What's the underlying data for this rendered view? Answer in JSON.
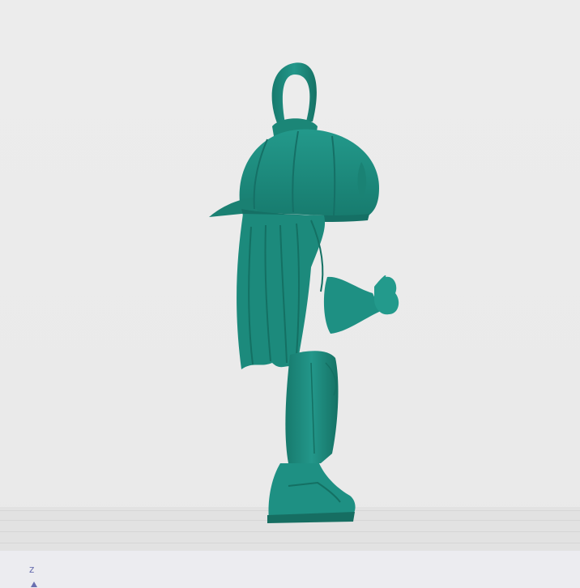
{
  "viewport": {
    "background_color": "#ebebeb",
    "model_color": "#1e8c7e"
  },
  "axis_gizmo": {
    "z_label": "z"
  }
}
